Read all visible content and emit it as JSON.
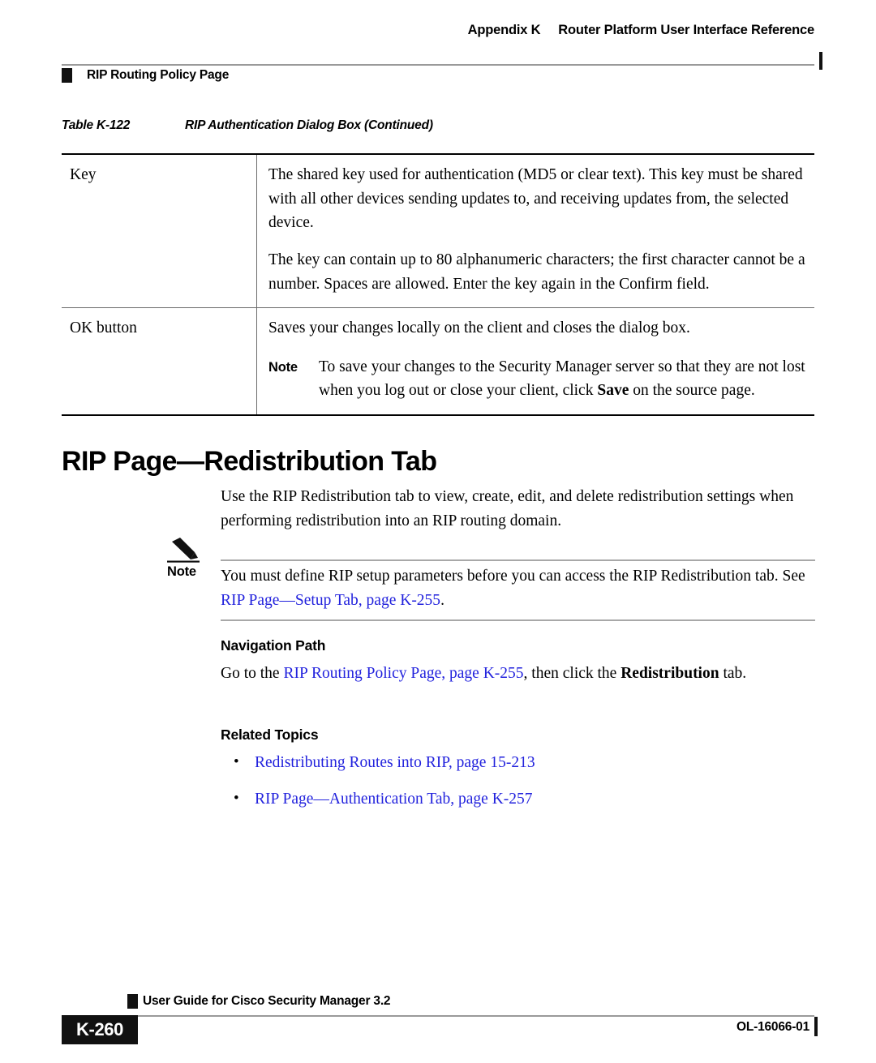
{
  "header": {
    "appendix": "Appendix K",
    "title": "Router Platform User Interface Reference",
    "section": "RIP Routing Policy Page"
  },
  "table": {
    "caption_number": "Table K-122",
    "caption_title": "RIP Authentication Dialog Box (Continued)",
    "rows": [
      {
        "term": "Key",
        "paragraphs": [
          "The shared key used for authentication (MD5 or clear text). This key must be shared with all other devices sending updates to, and receiving updates from, the selected device.",
          "The key can contain up to 80 alphanumeric characters; the first character cannot be a number. Spaces are allowed. Enter the key again in the Confirm field."
        ]
      },
      {
        "term": "OK button",
        "paragraphs": [
          "Saves your changes locally on the client and closes the dialog box."
        ],
        "note_label": "Note",
        "note_text_part1": "To save your changes to the Security Manager server so that they are not lost when you log out or close your client, click ",
        "note_bold": "Save",
        "note_text_part2": " on the source page."
      }
    ]
  },
  "section": {
    "heading": "RIP Page—Redistribution Tab",
    "intro": "Use the RIP Redistribution tab to view, create, edit, and delete redistribution settings when performing redistribution into an RIP routing domain."
  },
  "note": {
    "icon": "pencil-icon",
    "label": "Note",
    "text_before_link": "You must define RIP setup parameters before you can access the RIP Redistribution tab. See ",
    "link": "RIP Page—Setup Tab, page K-255",
    "text_after_link": "."
  },
  "navigation_path": {
    "heading": "Navigation Path",
    "text_before_link": "Go to the ",
    "link": "RIP Routing Policy Page, page K-255",
    "text_middle": ", then click the ",
    "bold": "Redistribution",
    "text_after": " tab."
  },
  "related_topics": {
    "heading": "Related Topics",
    "bullet": "•",
    "items": [
      "Redistributing Routes into RIP, page 15-213",
      "RIP Page—Authentication Tab, page K-257"
    ]
  },
  "footer": {
    "guide": "User Guide for Cisco Security Manager 3.2",
    "page_number": "K-260",
    "doc_id": "OL-16066-01"
  },
  "colors": {
    "link": "#2222dd",
    "rule": "#9a9a9a",
    "ink": "#111111"
  }
}
